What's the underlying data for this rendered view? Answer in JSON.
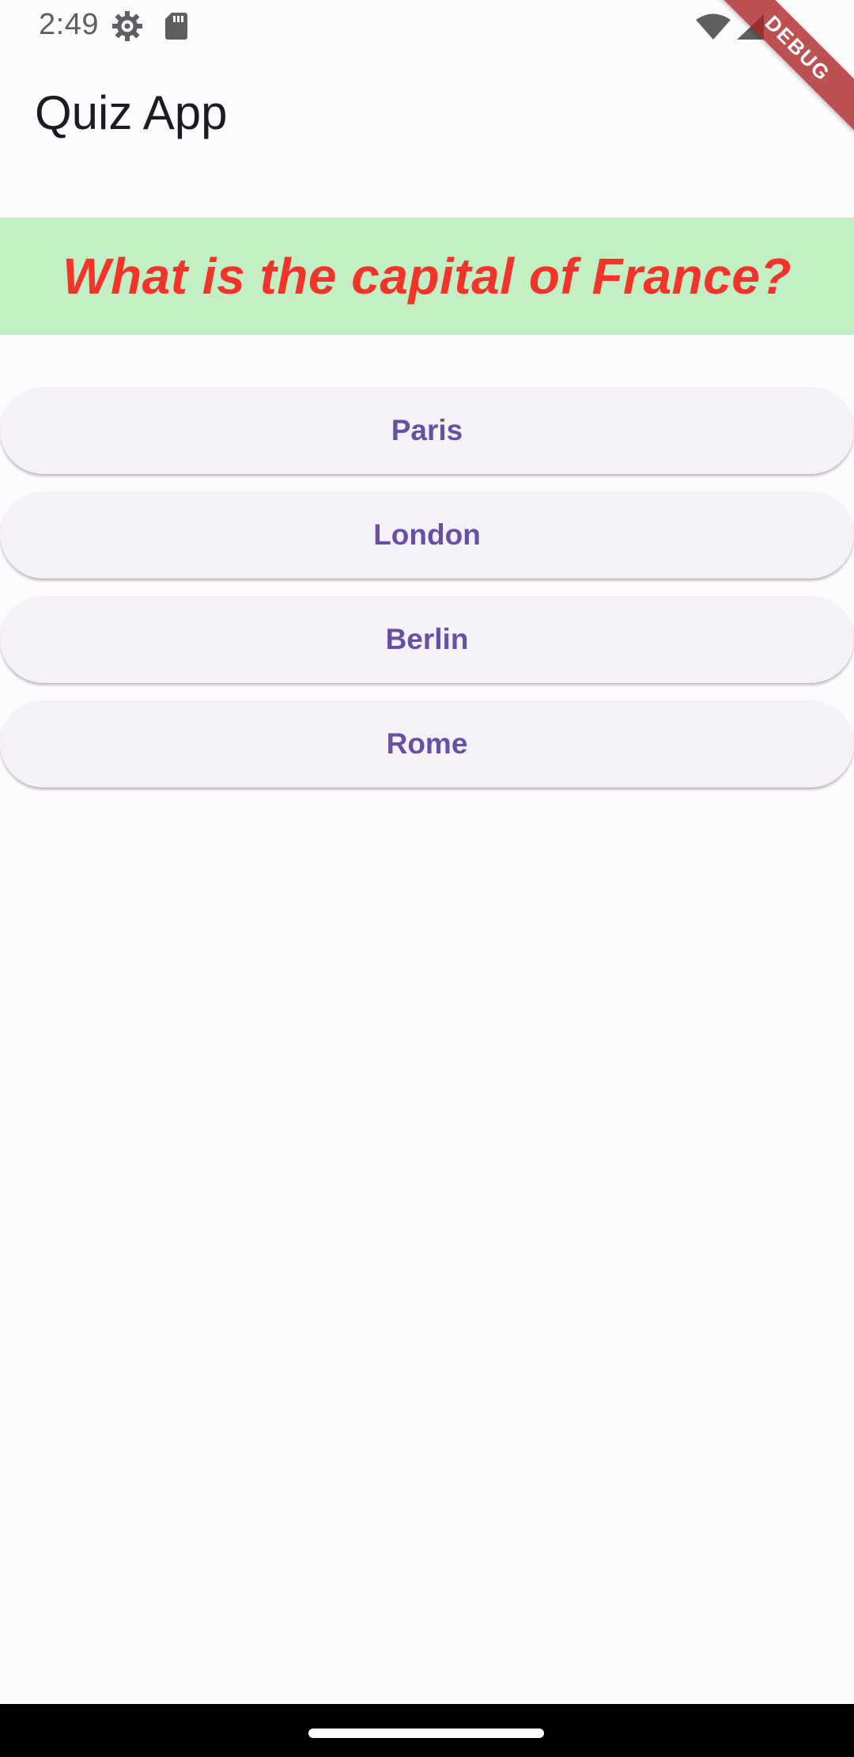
{
  "status_bar": {
    "time": "2:49",
    "icons": [
      "gear-icon",
      "sd-card-icon",
      "wifi-icon",
      "signal-icon"
    ]
  },
  "debug_banner": {
    "label": "DEBUG"
  },
  "app_bar": {
    "title": "Quiz App"
  },
  "question": {
    "text": "What is the capital of France?"
  },
  "answers": [
    {
      "label": "Paris"
    },
    {
      "label": "London"
    },
    {
      "label": "Berlin"
    },
    {
      "label": "Rome"
    }
  ],
  "colors": {
    "background": "#fefbff",
    "question_bg": "#c3efc5",
    "question_text": "#f2342a",
    "button_bg": "#f5f1f8",
    "button_text": "#6750a4"
  }
}
